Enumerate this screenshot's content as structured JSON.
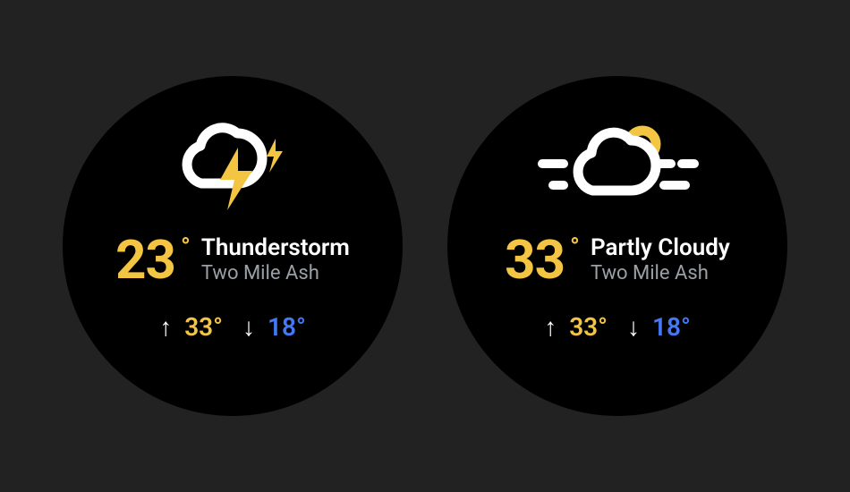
{
  "faces": [
    {
      "icon": "thunderstorm",
      "temperature": "23",
      "condition": "Thunderstorm",
      "location": "Two Mile Ash",
      "high": "33°",
      "low": "18°"
    },
    {
      "icon": "partly-cloudy",
      "temperature": "33",
      "condition": "Partly Cloudy",
      "location": "Two Mile Ash",
      "high": "33°",
      "low": "18°"
    }
  ],
  "colors": {
    "accent": "#f4c542",
    "background": "#222222",
    "face": "#000000",
    "text": "#ffffff",
    "muted": "#9aa0a6",
    "low": "#4378f6"
  }
}
